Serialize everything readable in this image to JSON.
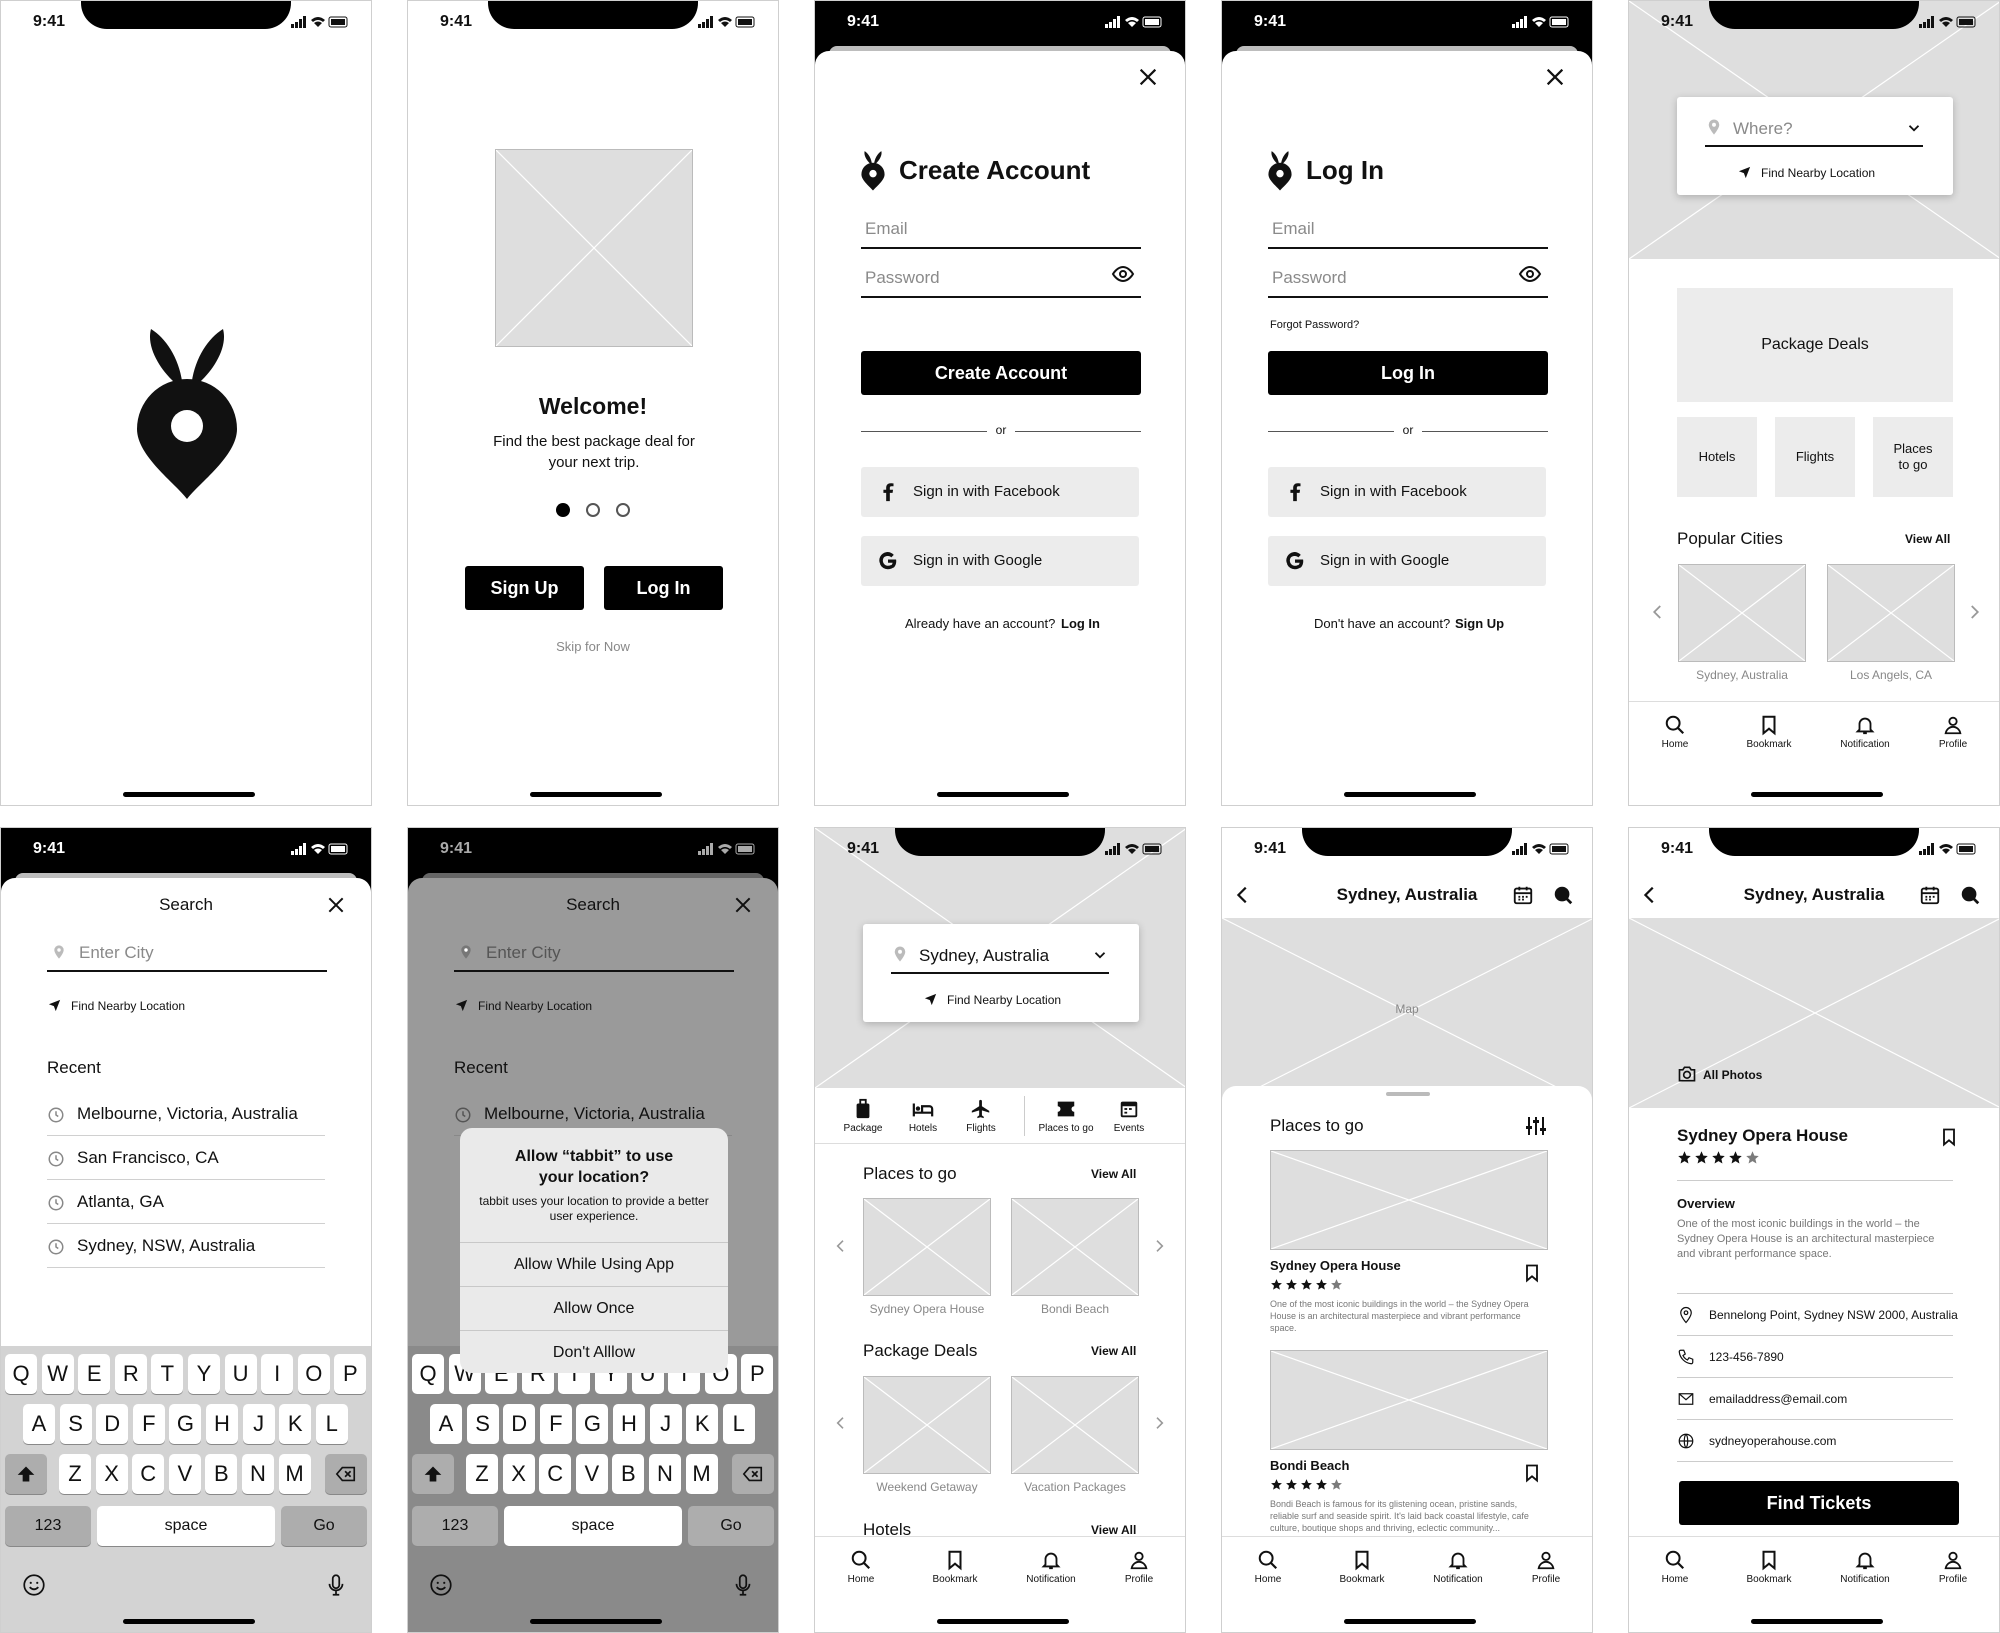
{
  "status": {
    "time": "9:41"
  },
  "welcome": {
    "title": "Welcome!",
    "subtitle": "Find the best package deal for your next trip.",
    "signup": "Sign Up",
    "login": "Log In",
    "skip": "Skip for Now"
  },
  "create": {
    "title": "Create Account",
    "email": "Email",
    "password": "Password",
    "button": "Create Account",
    "or": "or",
    "facebook": "Sign in with Facebook",
    "google": "Sign in with Google",
    "have": "Already have an account?",
    "have_link": "Log In"
  },
  "login": {
    "title": "Log In",
    "email": "Email",
    "password": "Password",
    "forgot": "Forgot Password?",
    "button": "Log In",
    "or": "or",
    "facebook": "Sign in with Facebook",
    "google": "Sign in with Google",
    "no": "Don't have an account?",
    "no_link": "Sign Up"
  },
  "home": {
    "where": "Where?",
    "nearby": "Find Nearby Location",
    "package": "Package Deals",
    "hotels": "Hotels",
    "flights": "Flights",
    "places": "Places to go",
    "popular": "Popular Cities",
    "viewall": "View All",
    "cities": [
      "Sydney, Australia",
      "Los Angels, CA"
    ]
  },
  "tabs": {
    "home": "Home",
    "bookmark": "Bookmark",
    "notification": "Notification",
    "profile": "Profile"
  },
  "search": {
    "title": "Search",
    "placeholder": "Enter City",
    "nearby": "Find Nearby Location",
    "recent": "Recent",
    "items": [
      "Melbourne, Victoria, Australia",
      "San Francisco, CA",
      "Atlanta, GA",
      "Sydney, NSW, Australia"
    ]
  },
  "keyboard": {
    "row1": [
      "Q",
      "W",
      "E",
      "R",
      "T",
      "Y",
      "U",
      "I",
      "O",
      "P"
    ],
    "row2": [
      "A",
      "S",
      "D",
      "F",
      "G",
      "H",
      "J",
      "K",
      "L"
    ],
    "row3": [
      "Z",
      "X",
      "C",
      "V",
      "B",
      "N",
      "M"
    ],
    "num": "123",
    "space": "space",
    "go": "Go"
  },
  "alert": {
    "title": "Allow “tabbit” to use your location?",
    "body": "tabbit uses your location to provide a better user experience.",
    "opt1": "Allow While Using App",
    "opt2": "Allow Once",
    "opt3": "Don't Alllow"
  },
  "city": {
    "location": "Sydney, Australia",
    "nearby": "Find Nearby Location",
    "cats": [
      "Package",
      "Hotels",
      "Flights",
      "Places to go",
      "Events"
    ],
    "places": "Places to go",
    "places_items": [
      "Sydney Opera House",
      "Bondi Beach"
    ],
    "packages": "Package Deals",
    "package_items": [
      "Weekend Getaway",
      "Vacation Packages"
    ],
    "hotels": "Hotels",
    "viewall": "View All"
  },
  "mapview": {
    "title": "Sydney, Australia",
    "map": "Map",
    "heading": "Places to go",
    "p1": "Sydney Opera House",
    "p1_desc": "One of the most iconic buildings in the world – the Sydney Opera House is an architectural masterpiece and vibrant performance space.",
    "p2": "Bondi Beach",
    "p2_desc": "Bondi Beach is famous for its glistening ocean, pristine sands, reliable surf and seaside spirit. It's laid back coastal lifestyle, cafe culture, boutique shops and thriving, eclectic community..."
  },
  "detail": {
    "title": "Sydney, Australia",
    "photos": "All Photos",
    "name": "Sydney Opera House",
    "overview": "Overview",
    "desc": "One of the most iconic buildings in the world – the Sydney Opera House is an architectural masterpiece and vibrant performance space.",
    "address": "Bennelong Point, Sydney NSW 2000, Australia",
    "phone": "123-456-7890",
    "email": "emailaddress@email.com",
    "web": "sydneyoperahouse.com",
    "tickets": "Find Tickets",
    "rating": 4.5
  }
}
